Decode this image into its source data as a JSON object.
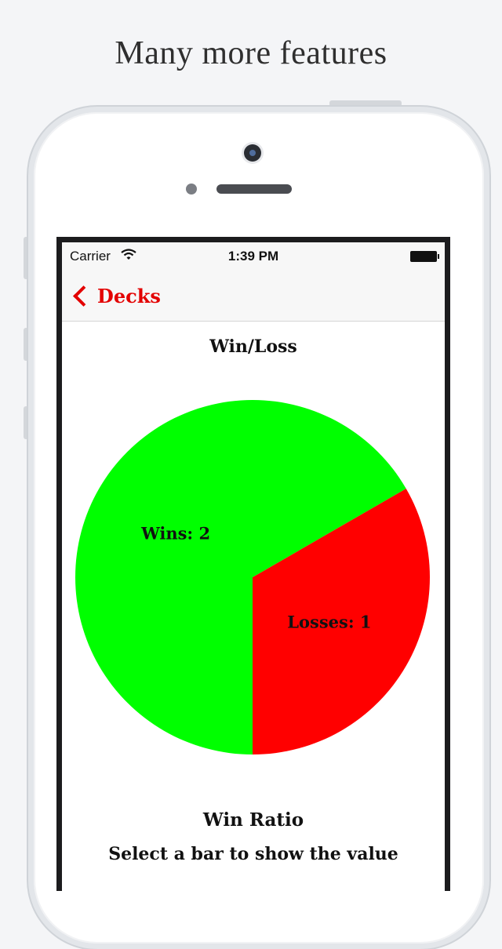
{
  "headline": "Many more features",
  "status_bar": {
    "carrier": "Carrier",
    "time": "1:39 PM",
    "wifi_icon": "wifi-icon",
    "battery_icon": "battery-icon"
  },
  "nav": {
    "back_label": "Decks",
    "back_icon": "chevron-left-icon",
    "accent_color": "#e30000"
  },
  "chart": {
    "title": "Win/Loss"
  },
  "chart_data": {
    "type": "pie",
    "title": "Win/Loss",
    "slices": [
      {
        "label": "Wins: 2",
        "name": "Wins",
        "value": 2,
        "color": "#00ff00"
      },
      {
        "label": "Losses: 1",
        "name": "Losses",
        "value": 1,
        "color": "#ff0000"
      }
    ]
  },
  "win_ratio": {
    "title": "Win Ratio",
    "hint": "Select a bar to show the value"
  }
}
